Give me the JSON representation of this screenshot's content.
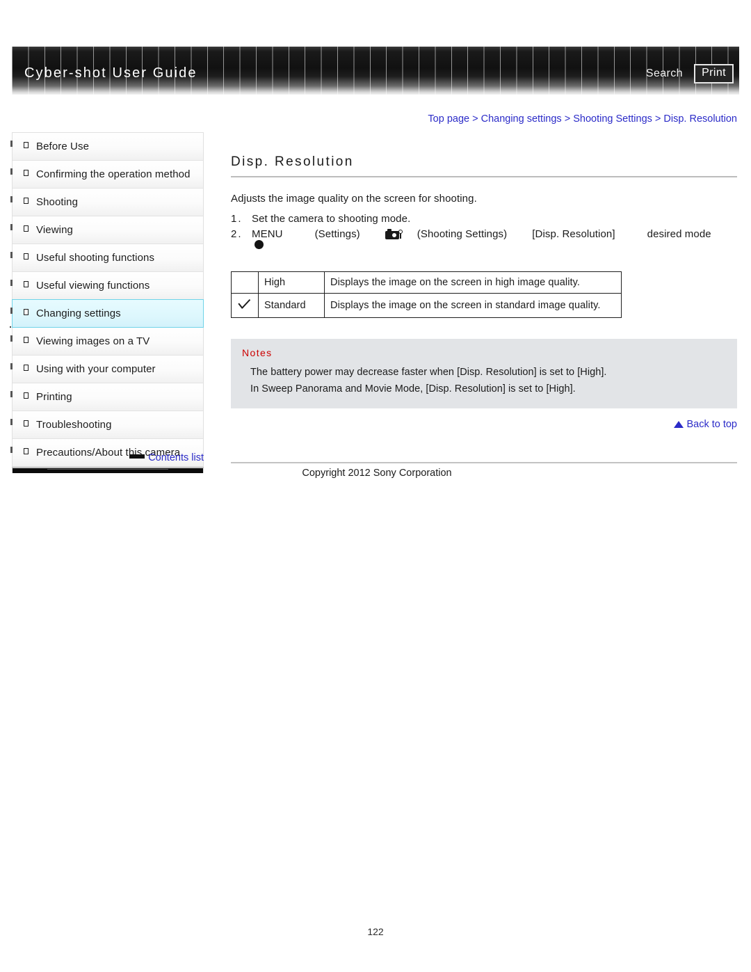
{
  "header": {
    "title": "Cyber-shot User Guide",
    "search_label": "Search",
    "print_label": "Print"
  },
  "breadcrumb": {
    "separator": " > ",
    "items": [
      "Top page",
      "Changing settings",
      "Shooting Settings",
      "Disp. Resolution"
    ]
  },
  "sidebar": {
    "items": [
      {
        "label": "Before Use",
        "icon": "square-bullet-icon",
        "active": false
      },
      {
        "label": "Confirming the operation method",
        "icon": "square-bullet-icon",
        "active": false
      },
      {
        "label": "Shooting",
        "icon": "square-bullet-icon",
        "active": false
      },
      {
        "label": "Viewing",
        "icon": "square-bullet-icon",
        "active": false
      },
      {
        "label": "Useful shooting functions",
        "icon": "square-bullet-icon",
        "active": false
      },
      {
        "label": "Useful viewing functions",
        "icon": "square-bullet-icon",
        "active": false
      },
      {
        "label": "Changing settings",
        "icon": "square-bullet-icon",
        "active": true
      },
      {
        "label": "Viewing images on a TV",
        "icon": "square-bullet-icon",
        "active": false
      },
      {
        "label": "Using with your computer",
        "icon": "square-bullet-icon",
        "active": false
      },
      {
        "label": "Printing",
        "icon": "square-bullet-icon",
        "active": false
      },
      {
        "label": "Troubleshooting",
        "icon": "square-bullet-icon",
        "active": false
      },
      {
        "label": "Precautions/About this camera",
        "icon": "square-bullet-icon",
        "active": false
      }
    ],
    "contents_link": "Contents list",
    "contents_icon": "black-bar-icon",
    "active_highlight_color": "#ddf7fd",
    "active_border_color": "#6fd3e8"
  },
  "main": {
    "title": "Disp. Resolution",
    "intro": "Adjusts the image quality on the screen for shooting.",
    "steps": [
      {
        "number": "1.",
        "text": "Set the camera to shooting mode."
      },
      {
        "number": "2.",
        "menu": "MENU",
        "settings": "(Settings)",
        "shooting_settings_icon": "camera-icon",
        "shooting_settings": "(Shooting Settings)",
        "item": "[Disp. Resolution]",
        "desired": "desired mode",
        "confirm_icon": "control-button-dot-icon"
      }
    ],
    "options_table": {
      "rows": [
        {
          "selected": false,
          "check_icon": "",
          "name": "High",
          "description": "Displays the image on the screen in high image quality."
        },
        {
          "selected": true,
          "check_icon": "check-mark-icon",
          "name": "Standard",
          "description": "Displays the image on the screen in standard image quality."
        }
      ]
    },
    "notes": {
      "title": "Notes",
      "title_color": "#cc0000",
      "background_color": "#e2e4e7",
      "items": [
        "The battery power may decrease faster when [Disp. Resolution] is set to [High].",
        "In Sweep Panorama and Movie Mode, [Disp. Resolution] is set to [High]."
      ]
    },
    "back_to_top": {
      "label": "Back to top",
      "icon": "up-triangle-icon",
      "color": "#2b2bc8"
    }
  },
  "footer": {
    "copyright": "Copyright 2012 Sony Corporation",
    "page_number": "122"
  }
}
